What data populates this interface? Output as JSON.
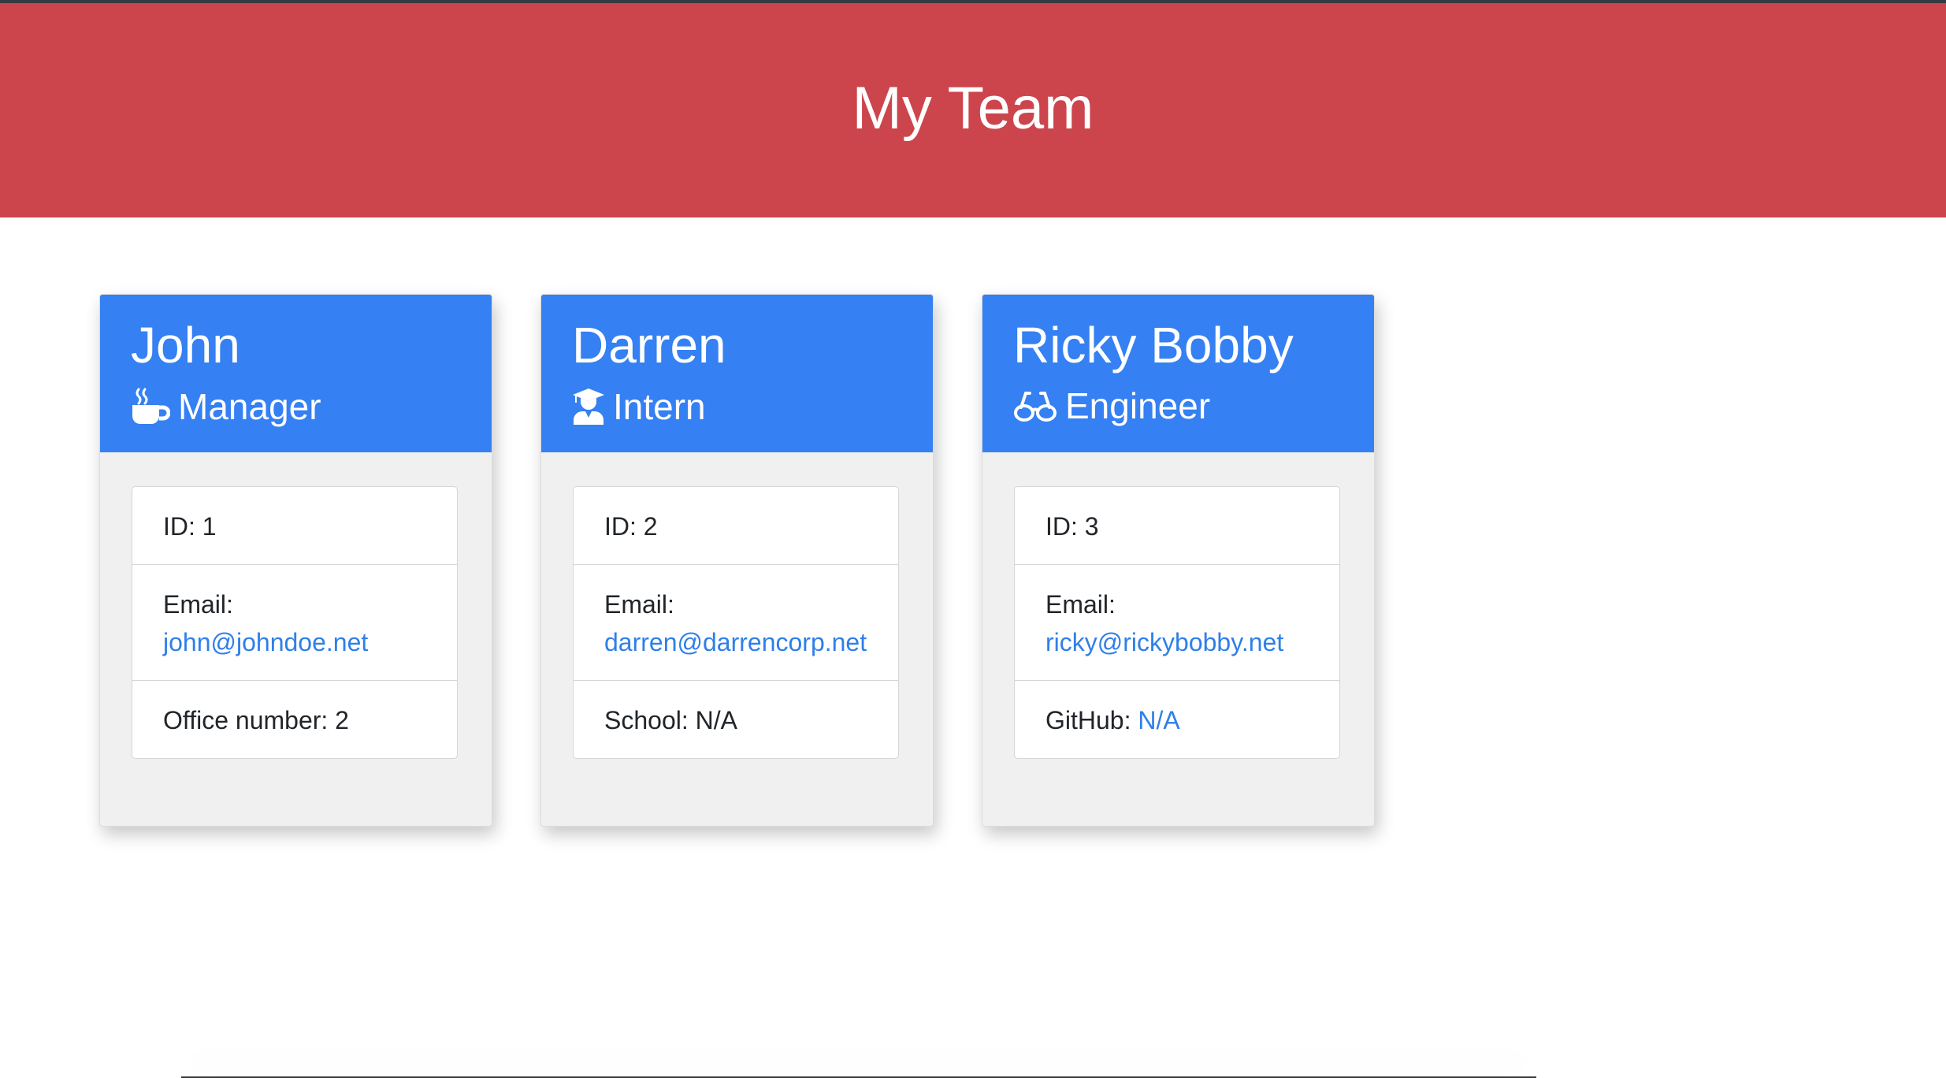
{
  "colors": {
    "header_bg": "#cc454c",
    "card_head_bg": "#3580f2",
    "link": "#2f7fe8"
  },
  "header": {
    "title": "My Team"
  },
  "cards": [
    {
      "name": "John",
      "role": "Manager",
      "role_icon": "coffee-icon",
      "id_label": "ID: 1",
      "email_label": "Email:",
      "email": "john@johndoe.net",
      "extra_label": "Office number: 2",
      "extra_value": ""
    },
    {
      "name": "Darren",
      "role": "Intern",
      "role_icon": "graduate-icon",
      "id_label": "ID: 2",
      "email_label": "Email:",
      "email": "darren@darrencorp.net",
      "extra_label": "School: N/A",
      "extra_value": ""
    },
    {
      "name": "Ricky Bobby",
      "role": "Engineer",
      "role_icon": "glasses-icon",
      "id_label": "ID: 3",
      "email_label": "Email:",
      "email": "ricky@rickybobby.net",
      "extra_label": "GitHub: ",
      "extra_value": "N/A"
    }
  ]
}
